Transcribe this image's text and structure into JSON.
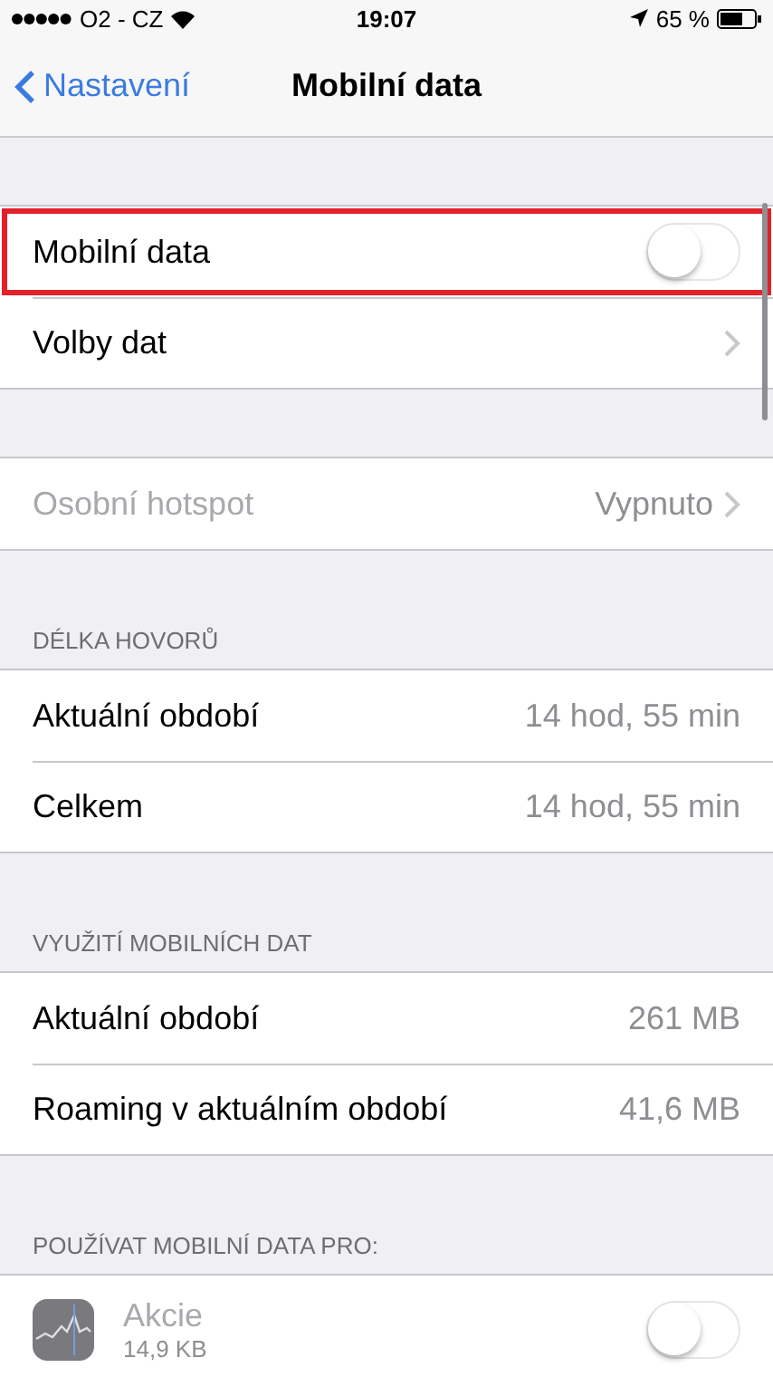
{
  "status_bar": {
    "carrier": "O2 - CZ",
    "time": "19:07",
    "battery": "65 %"
  },
  "nav": {
    "back": "Nastavení",
    "title": "Mobilní data"
  },
  "sections": [
    {
      "rows": [
        {
          "kind": "toggle",
          "label": "Mobilní data",
          "on": false,
          "highlighted": true
        },
        {
          "kind": "link",
          "label": "Volby dat",
          "disabled": false
        }
      ]
    },
    {
      "rows": [
        {
          "kind": "link",
          "label": "Osobní hotspot",
          "value": "Vypnuto",
          "disabled": true
        }
      ]
    },
    {
      "header": "DÉLKA HOVORŮ",
      "rows": [
        {
          "kind": "value",
          "label": "Aktuální období",
          "value": "14 hod, 55 min"
        },
        {
          "kind": "value",
          "label": "Celkem",
          "value": "14 hod, 55 min"
        }
      ]
    },
    {
      "header": "VYUŽITÍ MOBILNÍCH DAT",
      "rows": [
        {
          "kind": "value",
          "label": "Aktuální období",
          "value": "261 MB"
        },
        {
          "kind": "value",
          "label": "Roaming v aktuálním období",
          "value": "41,6 MB"
        }
      ]
    },
    {
      "header": "POUŽÍVAT MOBILNÍ DATA PRO:",
      "rows": [
        {
          "kind": "app",
          "label": "Akcie",
          "detail": "14,9 KB",
          "on": false
        }
      ]
    }
  ]
}
